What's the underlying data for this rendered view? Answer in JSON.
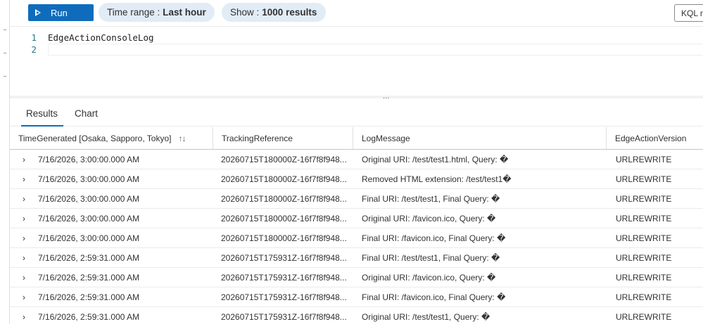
{
  "toolbar": {
    "run_label": "Run",
    "time_range_key": "Time range :",
    "time_range_value": "Last hour",
    "show_key": "Show :",
    "show_value": "1000 results",
    "kql_mode_label": "KQL m"
  },
  "editor": {
    "lines": [
      {
        "number": "1",
        "code": "EdgeActionConsoleLog"
      },
      {
        "number": "2",
        "code": ""
      }
    ]
  },
  "splitter_grip": "...",
  "tabs": {
    "results": "Results",
    "chart": "Chart",
    "active": "Results"
  },
  "grid": {
    "columns": [
      "TimeGenerated [Osaka, Sapporo, Tokyo]",
      "TrackingReference",
      "LogMessage",
      "EdgeActionVersion"
    ],
    "sort_icon": "↑↓",
    "expander_icon": "›",
    "rows": [
      {
        "time": "7/16/2026, 3:00:00.000 AM",
        "ref": "20260715T180000Z-16f7f8f948...",
        "msg": "Original URI: /test/test1.html, Query: �",
        "version": "URLREWRITE"
      },
      {
        "time": "7/16/2026, 3:00:00.000 AM",
        "ref": "20260715T180000Z-16f7f8f948...",
        "msg": "Removed HTML extension: /test/test1�",
        "version": "URLREWRITE"
      },
      {
        "time": "7/16/2026, 3:00:00.000 AM",
        "ref": "20260715T180000Z-16f7f8f948...",
        "msg": "Final URI: /test/test1, Final Query: �",
        "version": "URLREWRITE"
      },
      {
        "time": "7/16/2026, 3:00:00.000 AM",
        "ref": "20260715T180000Z-16f7f8f948...",
        "msg": "Original URI: /favicon.ico, Query: �",
        "version": "URLREWRITE"
      },
      {
        "time": "7/16/2026, 3:00:00.000 AM",
        "ref": "20260715T180000Z-16f7f8f948...",
        "msg": "Final URI: /favicon.ico, Final Query: �",
        "version": "URLREWRITE"
      },
      {
        "time": "7/16/2026, 2:59:31.000 AM",
        "ref": "20260715T175931Z-16f7f8f948...",
        "msg": "Final URI: /test/test1, Final Query: �",
        "version": "URLREWRITE"
      },
      {
        "time": "7/16/2026, 2:59:31.000 AM",
        "ref": "20260715T175931Z-16f7f8f948...",
        "msg": "Original URI: /favicon.ico, Query: �",
        "version": "URLREWRITE"
      },
      {
        "time": "7/16/2026, 2:59:31.000 AM",
        "ref": "20260715T175931Z-16f7f8f948...",
        "msg": "Final URI: /favicon.ico, Final Query: �",
        "version": "URLREWRITE"
      },
      {
        "time": "7/16/2026, 2:59:31.000 AM",
        "ref": "20260715T175931Z-16f7f8f948...",
        "msg": "Original URI: /test/test1, Query: �",
        "version": "URLREWRITE"
      }
    ]
  },
  "colors": {
    "accent": "#0f6cbd",
    "pill_background": "#e1ecf7",
    "line_number": "#237893"
  }
}
